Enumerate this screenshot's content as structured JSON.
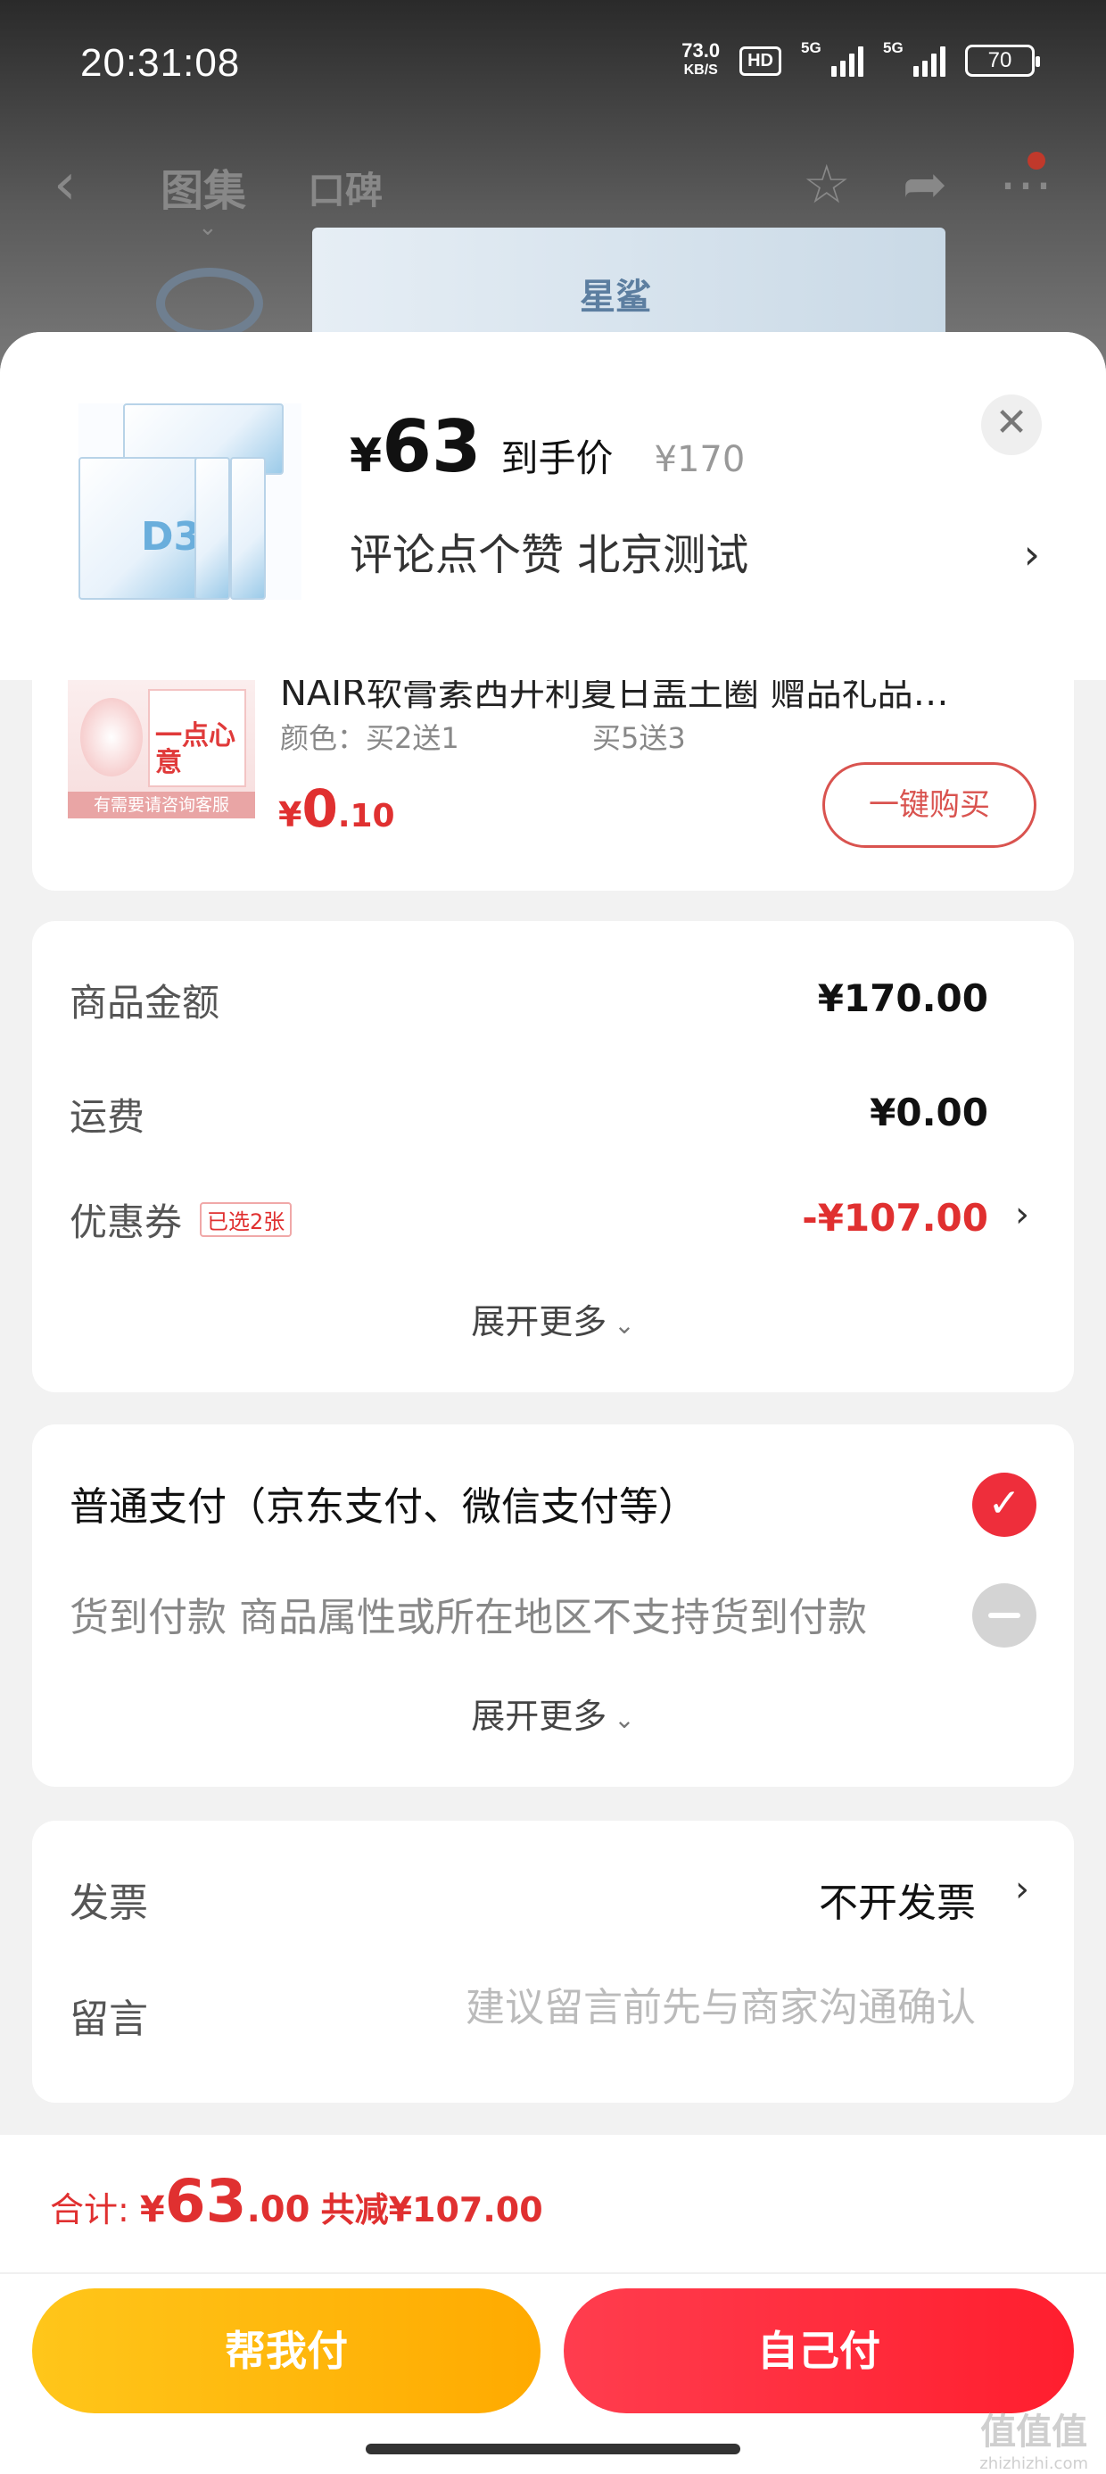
{
  "status_bar": {
    "time": "20:31:08",
    "net_speed": "73.0",
    "net_unit": "KB/S",
    "hd": "HD",
    "sig1": "5G",
    "sig2": "5G",
    "battery": "70"
  },
  "nav": {
    "tab1": "图集",
    "tab2": "口碑",
    "brand_text": "星鲨"
  },
  "sheet_header": {
    "currency": "¥",
    "price": "63",
    "price_label": "到手价",
    "original_price": "¥170",
    "promo_text": "评论点个赞  北京测试",
    "product_box_label": "D3"
  },
  "gift": {
    "name": "NAIR软膏素西开利夏日盖土圈 赠品礼品…",
    "spec1": "颜色：买2送1",
    "spec2": "买5送3",
    "image_caption": "有需要请咨询客服",
    "image_text": "一点心意",
    "price_symbol": "¥",
    "price_int": "0",
    "price_dec": ".10",
    "buy_label": "一键购买"
  },
  "amounts": {
    "goods_label": "商品金额",
    "goods_value": "¥170.00",
    "shipping_label": "运费",
    "shipping_value": "¥0.00",
    "coupon_label": "优惠券",
    "coupon_tag": "已选2张",
    "coupon_value": "-¥107.00",
    "more_label": "展开更多"
  },
  "payment": {
    "normal_label": "普通支付（京东支付、微信支付等）",
    "cod_label": "货到付款 商品属性或所在地区不支持货到付款",
    "more_label": "展开更多"
  },
  "invoice": {
    "invoice_label": "发票",
    "invoice_value": "不开发票",
    "message_label": "留言",
    "message_placeholder": "建议留言前先与商家沟通确认"
  },
  "footer": {
    "total_label": "合计:",
    "total_symbol": "¥",
    "total_int": "63",
    "total_dec": ".00",
    "discount_text": "共减¥107.00",
    "help_pay_label": "帮我付",
    "self_pay_label": "自己付",
    "watermark": "值值值",
    "watermark_small": "zhizhizhi.com"
  },
  "colors": {
    "accent_red": "#e03030",
    "pay_red": "#ff2f3f",
    "help_yellow": "#ffb800"
  }
}
